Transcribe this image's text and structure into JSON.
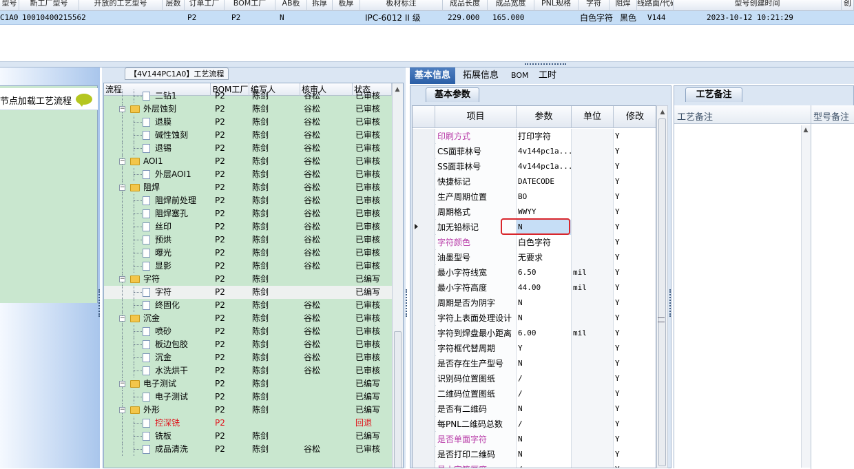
{
  "top_grid": {
    "headers": [
      "型号",
      "新工厂型号",
      "开放的工艺型号",
      "层数",
      "订单工厂",
      "BOM工厂",
      "AB板",
      "拆厚",
      "板厚",
      "板材标注",
      "成品长度",
      "成品宽度",
      "PNL规格",
      "字符",
      "阻焊",
      "线路面/代码",
      "型号创建时间",
      "创"
    ],
    "row": [
      "C1A0",
      "10010400215562",
      "",
      "",
      "P2",
      "P2",
      "N",
      "",
      "",
      "IPC-6012 II 级",
      "229.000",
      "165.000",
      "",
      "白色字符",
      "黑色",
      "V144",
      "2023-10-12 10:21:29",
      ""
    ]
  },
  "left_panel": {
    "hint": "节点加载工艺流程",
    "chat_icon": "speech-bubble-icon"
  },
  "tree_panel": {
    "title": "【4V144PC1A0】工艺流程",
    "columns": [
      "流程",
      "BOM工厂",
      "编写人",
      "核审人",
      "状态"
    ],
    "rows": [
      {
        "type": "child",
        "name": "二钻1",
        "bom": "P2",
        "writer": "陈剑",
        "reviewer": "谷松",
        "status": "已审核"
      },
      {
        "type": "folder",
        "name": "外层蚀刻",
        "bom": "P2",
        "writer": "陈剑",
        "reviewer": "谷松",
        "status": "已审核"
      },
      {
        "type": "child",
        "name": "退膜",
        "bom": "P2",
        "writer": "陈剑",
        "reviewer": "谷松",
        "status": "已审核"
      },
      {
        "type": "child",
        "name": "碱性蚀刻",
        "bom": "P2",
        "writer": "陈剑",
        "reviewer": "谷松",
        "status": "已审核"
      },
      {
        "type": "child",
        "name": "退锡",
        "bom": "P2",
        "writer": "陈剑",
        "reviewer": "谷松",
        "status": "已审核"
      },
      {
        "type": "folder",
        "name": "AOI1",
        "bom": "P2",
        "writer": "陈剑",
        "reviewer": "谷松",
        "status": "已审核"
      },
      {
        "type": "child",
        "name": "外层AOI1",
        "bom": "P2",
        "writer": "陈剑",
        "reviewer": "谷松",
        "status": "已审核"
      },
      {
        "type": "folder",
        "name": "阻焊",
        "bom": "P2",
        "writer": "陈剑",
        "reviewer": "谷松",
        "status": "已审核"
      },
      {
        "type": "child",
        "name": "阻焊前处理",
        "bom": "P2",
        "writer": "陈剑",
        "reviewer": "谷松",
        "status": "已审核"
      },
      {
        "type": "child",
        "name": "阻焊塞孔",
        "bom": "P2",
        "writer": "陈剑",
        "reviewer": "谷松",
        "status": "已审核"
      },
      {
        "type": "child",
        "name": "丝印",
        "bom": "P2",
        "writer": "陈剑",
        "reviewer": "谷松",
        "status": "已审核"
      },
      {
        "type": "child",
        "name": "预烘",
        "bom": "P2",
        "writer": "陈剑",
        "reviewer": "谷松",
        "status": "已审核"
      },
      {
        "type": "child",
        "name": "曝光",
        "bom": "P2",
        "writer": "陈剑",
        "reviewer": "谷松",
        "status": "已审核"
      },
      {
        "type": "child",
        "name": "显影",
        "bom": "P2",
        "writer": "陈剑",
        "reviewer": "谷松",
        "status": "已审核"
      },
      {
        "type": "folder",
        "name": "字符",
        "bom": "P2",
        "writer": "陈剑",
        "reviewer": "",
        "status": "已编写"
      },
      {
        "type": "child",
        "name": "字符",
        "bom": "P2",
        "writer": "陈剑",
        "reviewer": "",
        "status": "已编写",
        "selected": true
      },
      {
        "type": "child",
        "name": "终固化",
        "bom": "P2",
        "writer": "陈剑",
        "reviewer": "谷松",
        "status": "已审核"
      },
      {
        "type": "folder",
        "name": "沉金",
        "bom": "P2",
        "writer": "陈剑",
        "reviewer": "谷松",
        "status": "已审核"
      },
      {
        "type": "child",
        "name": "喷砂",
        "bom": "P2",
        "writer": "陈剑",
        "reviewer": "谷松",
        "status": "已审核"
      },
      {
        "type": "child",
        "name": "板边包胶",
        "bom": "P2",
        "writer": "陈剑",
        "reviewer": "谷松",
        "status": "已审核"
      },
      {
        "type": "child",
        "name": "沉金",
        "bom": "P2",
        "writer": "陈剑",
        "reviewer": "谷松",
        "status": "已审核"
      },
      {
        "type": "child",
        "name": "水洗烘干",
        "bom": "P2",
        "writer": "陈剑",
        "reviewer": "谷松",
        "status": "已审核"
      },
      {
        "type": "folder",
        "name": "电子测试",
        "bom": "P2",
        "writer": "陈剑",
        "reviewer": "",
        "status": "已编写"
      },
      {
        "type": "child",
        "name": "电子测试",
        "bom": "P2",
        "writer": "陈剑",
        "reviewer": "",
        "status": "已编写"
      },
      {
        "type": "folder",
        "name": "外形",
        "bom": "P2",
        "writer": "陈剑",
        "reviewer": "",
        "status": "已编写"
      },
      {
        "type": "child",
        "name": "控深铣",
        "bom": "P2",
        "writer": "",
        "reviewer": "",
        "status": "回退",
        "red": true
      },
      {
        "type": "child",
        "name": "铣板",
        "bom": "P2",
        "writer": "陈剑",
        "reviewer": "",
        "status": "已编写"
      },
      {
        "type": "child",
        "name": "成品清洗",
        "bom": "P2",
        "writer": "陈剑",
        "reviewer": "谷松",
        "status": "已审核"
      }
    ]
  },
  "right_tabs": [
    "基本信息",
    "拓展信息",
    "BOM",
    "工时"
  ],
  "param_panel": {
    "tab": "基本参数",
    "columns": [
      "项目",
      "参数",
      "单位",
      "修改"
    ],
    "rows": [
      {
        "item": "印刷方式",
        "value": "打印字符",
        "unit": "",
        "mod": "Y",
        "pink": true
      },
      {
        "item": "CS面菲林号",
        "value": "4v144pc1a...",
        "unit": "",
        "mod": "Y"
      },
      {
        "item": "SS面菲林号",
        "value": "4v144pc1a...",
        "unit": "",
        "mod": "Y"
      },
      {
        "item": "快捷标记",
        "value": "DATECODE",
        "unit": "",
        "mod": "Y"
      },
      {
        "item": "生产周期位置",
        "value": "BO",
        "unit": "",
        "mod": "Y"
      },
      {
        "item": "周期格式",
        "value": "WWYY",
        "unit": "",
        "mod": "Y"
      },
      {
        "item": "加无铅标记",
        "value": "N",
        "unit": "",
        "mod": "Y",
        "current": true
      },
      {
        "item": "字符颜色",
        "value": "白色字符",
        "unit": "",
        "mod": "Y",
        "pink": true
      },
      {
        "item": "油墨型号",
        "value": "无要求",
        "unit": "",
        "mod": "Y"
      },
      {
        "item": "最小字符线宽",
        "value": "6.50",
        "unit": "mil",
        "mod": "Y"
      },
      {
        "item": "最小字符高度",
        "value": "44.00",
        "unit": "mil",
        "mod": "Y"
      },
      {
        "item": "周期是否为阴字",
        "value": "N",
        "unit": "",
        "mod": "Y"
      },
      {
        "item": "字符上表面处理设计",
        "value": "N",
        "unit": "",
        "mod": "Y"
      },
      {
        "item": "字符到焊盘最小距离",
        "value": "6.00",
        "unit": "mil",
        "mod": "Y"
      },
      {
        "item": "字符框代替周期",
        "value": "Y",
        "unit": "",
        "mod": "Y"
      },
      {
        "item": "是否存在生产型号",
        "value": "N",
        "unit": "",
        "mod": "Y"
      },
      {
        "item": "识别码位置图纸",
        "value": "/",
        "unit": "",
        "mod": "Y"
      },
      {
        "item": "二维码位置图纸",
        "value": "/",
        "unit": "",
        "mod": "Y"
      },
      {
        "item": "是否有二维码",
        "value": "N",
        "unit": "",
        "mod": "Y"
      },
      {
        "item": "每PNL二维码总数",
        "value": "/",
        "unit": "",
        "mod": "Y"
      },
      {
        "item": "是否单面字符",
        "value": "N",
        "unit": "",
        "mod": "Y",
        "pink": true
      },
      {
        "item": "是否打印二维码",
        "value": "N",
        "unit": "",
        "mod": "Y"
      },
      {
        "item": "最小字符厚度",
        "value": "/",
        "unit": "",
        "mod": "Y",
        "pink": true
      }
    ]
  },
  "remark_panel": {
    "tab": "工艺备注",
    "col1": "工艺备注",
    "col2": "型号备注"
  },
  "colors": {
    "accent": "#2a5ea6",
    "tree_bg": "#c9e7cf",
    "highlight_border": "#d9262c"
  }
}
